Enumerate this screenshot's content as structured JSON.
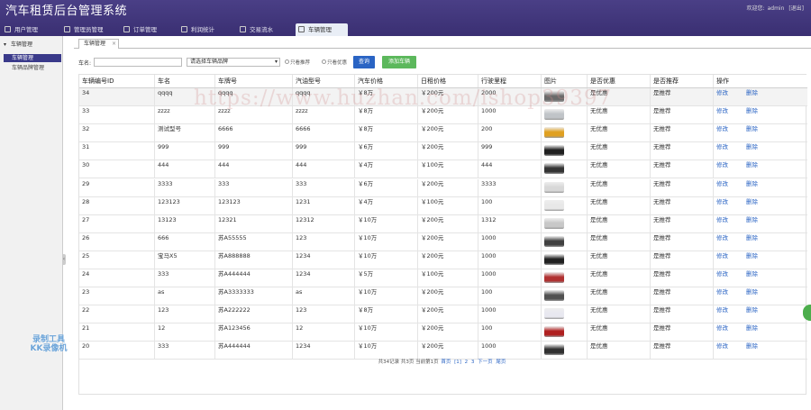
{
  "app": {
    "title": "汽车租赁后台管理系统",
    "user_label": "欢迎您:",
    "user_name": "admin",
    "logout": "[退出]"
  },
  "nav": {
    "tabs": [
      {
        "label": "用户管理"
      },
      {
        "label": "管理员管理"
      },
      {
        "label": "订单管理"
      },
      {
        "label": "利润统计"
      },
      {
        "label": "交易流水"
      },
      {
        "label": "车辆管理"
      }
    ]
  },
  "sidebar": {
    "group": "车辆管理",
    "items": [
      {
        "label": "车辆管理"
      },
      {
        "label": "车辆品牌管理"
      }
    ]
  },
  "page_tab": {
    "label": "车辆管理",
    "close": "×"
  },
  "filter": {
    "name_label": "车名:",
    "name_value": "",
    "brand_select": "请选择车辆品牌",
    "radio_recommend": "只看推荐",
    "radio_discount": "只看优惠",
    "query_button": "查询",
    "add_button": "添加车辆"
  },
  "table": {
    "headers": [
      "车辆编号ID",
      "车名",
      "车牌号",
      "汽油型号",
      "汽车价格",
      "日租价格",
      "行驶里程",
      "图片",
      "是否优惠",
      "是否推荐",
      "操作"
    ],
    "edit_label": "修改",
    "delete_label": "删除",
    "rows": [
      {
        "id": "34",
        "name": "qqqq",
        "plate": "qqqq",
        "fuel": "qqqq",
        "price": "￥8万",
        "daily": "￥200元",
        "mileage": "2000",
        "discount": "是优惠",
        "recommend": "是推荐",
        "img": "#6a6a6a"
      },
      {
        "id": "33",
        "name": "zzzz",
        "plate": "zzzz",
        "fuel": "zzzz",
        "price": "￥8万",
        "daily": "￥200元",
        "mileage": "1000",
        "discount": "无优惠",
        "recommend": "是推荐",
        "img": "#c0c4c8"
      },
      {
        "id": "32",
        "name": "测试型号",
        "plate": "6666",
        "fuel": "6666",
        "price": "￥8万",
        "daily": "￥200元",
        "mileage": "200",
        "discount": "无优惠",
        "recommend": "无推荐",
        "img": "#e0a020"
      },
      {
        "id": "31",
        "name": "999",
        "plate": "999",
        "fuel": "999",
        "price": "￥6万",
        "daily": "￥200元",
        "mileage": "999",
        "discount": "无优惠",
        "recommend": "无推荐",
        "img": "#202020"
      },
      {
        "id": "30",
        "name": "444",
        "plate": "444",
        "fuel": "444",
        "price": "￥4万",
        "daily": "￥100元",
        "mileage": "444",
        "discount": "无优惠",
        "recommend": "无推荐",
        "img": "#333333"
      },
      {
        "id": "29",
        "name": "3333",
        "plate": "333",
        "fuel": "333",
        "price": "￥6万",
        "daily": "￥200元",
        "mileage": "3333",
        "discount": "无优惠",
        "recommend": "无推荐",
        "img": "#d8d8d8"
      },
      {
        "id": "28",
        "name": "123123",
        "plate": "123123",
        "fuel": "1231",
        "price": "￥4万",
        "daily": "￥100元",
        "mileage": "100",
        "discount": "无优惠",
        "recommend": "无推荐",
        "img": "#e8e8e8"
      },
      {
        "id": "27",
        "name": "13123",
        "plate": "12321",
        "fuel": "12312",
        "price": "￥10万",
        "daily": "￥200元",
        "mileage": "1312",
        "discount": "是优惠",
        "recommend": "无推荐",
        "img": "#c8c8c8"
      },
      {
        "id": "26",
        "name": "666",
        "plate": "苏A55555",
        "fuel": "123",
        "price": "￥10万",
        "daily": "￥200元",
        "mileage": "1000",
        "discount": "是优惠",
        "recommend": "是推荐",
        "img": "#404040"
      },
      {
        "id": "25",
        "name": "宝马X5",
        "plate": "苏A888888",
        "fuel": "1234",
        "price": "￥10万",
        "daily": "￥200元",
        "mileage": "1000",
        "discount": "无优惠",
        "recommend": "是推荐",
        "img": "#202020"
      },
      {
        "id": "24",
        "name": "333",
        "plate": "苏A444444",
        "fuel": "1234",
        "price": "￥5万",
        "daily": "￥100元",
        "mileage": "1000",
        "discount": "无优惠",
        "recommend": "是推荐",
        "img": "#b03030"
      },
      {
        "id": "23",
        "name": "as",
        "plate": "苏A3333333",
        "fuel": "as",
        "price": "￥10万",
        "daily": "￥200元",
        "mileage": "100",
        "discount": "无优惠",
        "recommend": "是推荐",
        "img": "#505050"
      },
      {
        "id": "22",
        "name": "123",
        "plate": "苏A222222",
        "fuel": "123",
        "price": "￥8万",
        "daily": "￥200元",
        "mileage": "1000",
        "discount": "无优惠",
        "recommend": "是推荐",
        "img": "#e8e8f0"
      },
      {
        "id": "21",
        "name": "12",
        "plate": "苏A123456",
        "fuel": "12",
        "price": "￥10万",
        "daily": "￥200元",
        "mileage": "100",
        "discount": "无优惠",
        "recommend": "是推荐",
        "img": "#b02020"
      },
      {
        "id": "20",
        "name": "333",
        "plate": "苏A444444",
        "fuel": "1234",
        "price": "￥10万",
        "daily": "￥200元",
        "mileage": "1000",
        "discount": "是优惠",
        "recommend": "是推荐",
        "img": "#303030"
      }
    ]
  },
  "pager": {
    "summary": "共34记录 共3页 当前第1页",
    "first": "首页",
    "pages": [
      "[1]",
      "2",
      "3"
    ],
    "next": "下一页",
    "last": "尾页"
  },
  "overlays": {
    "watermark": "https://www.huzhan.com/ishop39397",
    "kk_line1": "录制工具",
    "kk_line2": "KK录像机"
  }
}
